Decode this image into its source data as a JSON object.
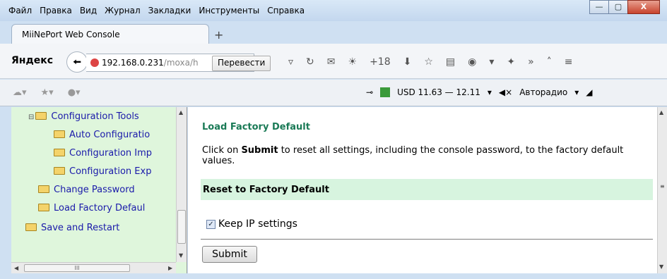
{
  "menu": [
    "Файл",
    "Правка",
    "Вид",
    "Журнал",
    "Закладки",
    "Инструменты",
    "Справка"
  ],
  "window_controls": {
    "minimize": "—",
    "maximize": "▢",
    "close": "X"
  },
  "tab": {
    "title": "MiiNePort Web Console",
    "new_tab": "+"
  },
  "nav": {
    "brand": "Яндекс",
    "url_host": "192.168.0.231",
    "url_path": "/moxa/h",
    "translate": "Перевести",
    "weather": "+18"
  },
  "bookmarks": {
    "rate": "USD 11.63 — 12.11",
    "radio": "Авторадио"
  },
  "sidebar": {
    "items": [
      {
        "label": "Configuration Tools"
      },
      {
        "label": "Auto Configuratio"
      },
      {
        "label": "Configuration Imp"
      },
      {
        "label": "Configuration Exp"
      },
      {
        "label": "Change Password"
      },
      {
        "label": "Load Factory Defaul"
      },
      {
        "label": "Save and Restart"
      }
    ],
    "hscroll_grip": "III"
  },
  "page": {
    "title": "Load Factory Default",
    "desc_pre": "Click on ",
    "desc_bold": "Submit",
    "desc_post": " to reset all settings, including the console password, to the factory default values.",
    "section": "Reset to Factory Default",
    "keep_ip": "Keep IP settings",
    "keep_ip_checked": true,
    "submit": "Submit"
  }
}
